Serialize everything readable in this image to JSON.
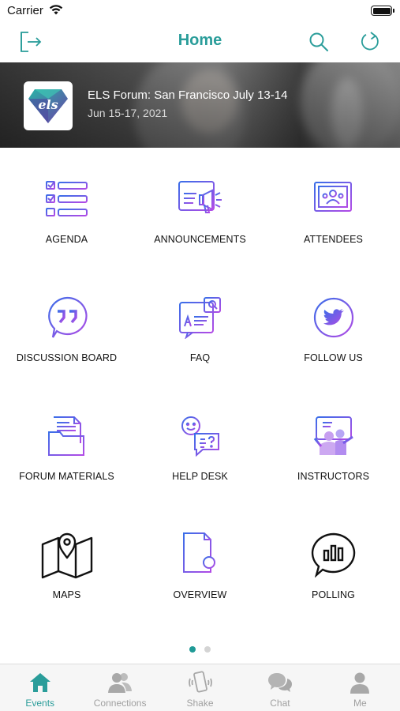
{
  "status_bar": {
    "carrier": "Carrier"
  },
  "nav": {
    "title": "Home",
    "icons": [
      "logout-icon",
      "search-icon",
      "refresh-icon"
    ]
  },
  "banner": {
    "logo_text": "els",
    "title": "ELS Forum: San Francisco July 13-14",
    "date": "Jun 15-17, 2021"
  },
  "tiles": [
    {
      "label": "AGENDA",
      "icon": "agenda-checklist-icon"
    },
    {
      "label": "ANNOUNCEMENTS",
      "icon": "announcements-megaphone-icon"
    },
    {
      "label": "ATTENDEES",
      "icon": "attendees-icon"
    },
    {
      "label": "DISCUSSION BOARD",
      "icon": "discussion-quote-bubble-icon"
    },
    {
      "label": "FAQ",
      "icon": "faq-icon"
    },
    {
      "label": "FOLLOW US",
      "icon": "twitter-bird-icon"
    },
    {
      "label": "FORUM MATERIALS",
      "icon": "folder-documents-icon"
    },
    {
      "label": "HELP DESK",
      "icon": "help-desk-icon"
    },
    {
      "label": "INSTRUCTORS",
      "icon": "instructors-board-icon"
    },
    {
      "label": "MAPS",
      "icon": "map-pin-icon"
    },
    {
      "label": "OVERVIEW",
      "icon": "overview-document-search-icon"
    },
    {
      "label": "POLLING",
      "icon": "polling-chart-bubble-icon"
    }
  ],
  "pager": {
    "pages": 2,
    "current": 1
  },
  "tabs": [
    {
      "label": "Events",
      "icon": "home-icon",
      "active": true
    },
    {
      "label": "Connections",
      "icon": "people-icon",
      "active": false
    },
    {
      "label": "Shake",
      "icon": "phone-shake-icon",
      "active": false
    },
    {
      "label": "Chat",
      "icon": "chat-bubbles-icon",
      "active": false
    },
    {
      "label": "Me",
      "icon": "person-icon",
      "active": false
    }
  ],
  "colors": {
    "accent": "#2a9d9a",
    "icon_gradient_start": "#3a6ee8",
    "icon_gradient_end": "#b24be6"
  }
}
